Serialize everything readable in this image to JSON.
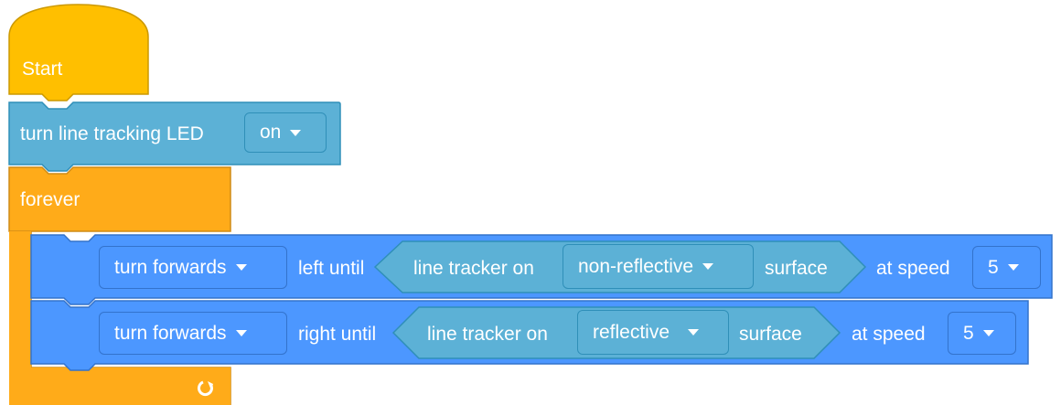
{
  "start_block": {
    "label": "Start"
  },
  "led_block": {
    "label": "turn line tracking LED",
    "value": "on"
  },
  "forever_block": {
    "label": "forever",
    "loop_icon": "loop-arrow-icon"
  },
  "turn_blocks": [
    {
      "direction": "turn forwards",
      "side_label": "left until",
      "condition": {
        "prefix": "line tracker on",
        "surface": "non-reflective",
        "suffix": "surface"
      },
      "speed_label": "at speed",
      "speed": "5"
    },
    {
      "direction": "turn forwards",
      "side_label": "right until",
      "condition": {
        "prefix": "line tracker on",
        "surface": "reflective",
        "suffix": "surface"
      },
      "speed_label": "at speed",
      "speed": "5"
    }
  ],
  "colors": {
    "event": "#ffbf00",
    "control": "#ffab19",
    "sensing": "#5cb1d6",
    "motion": "#4c97ff"
  }
}
